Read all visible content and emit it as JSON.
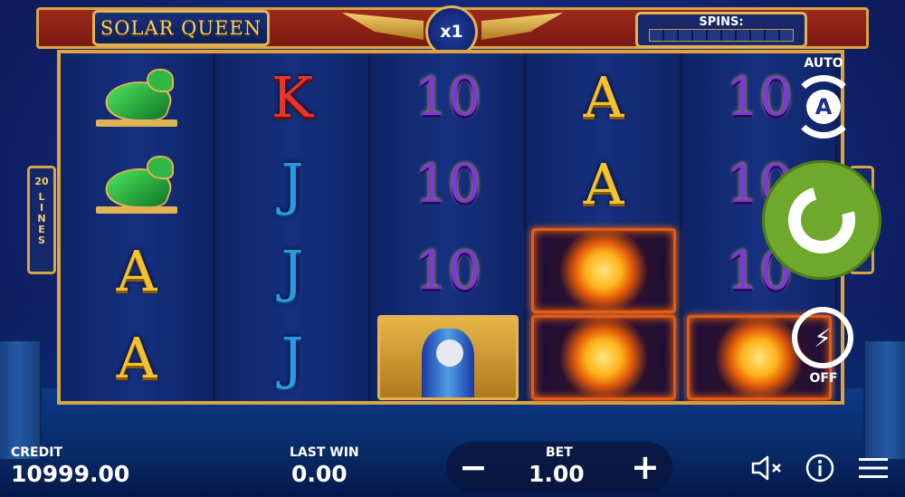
{
  "game": {
    "logo": "SOLAR QUEEN",
    "multiplier": "x1",
    "spins_label": "SPINS:",
    "lines_number": "20",
    "lines_word": "LINES"
  },
  "reels": [
    [
      "bird",
      "bird",
      "A",
      "A"
    ],
    [
      "K",
      "J",
      "J",
      "J"
    ],
    [
      "10",
      "10",
      "10",
      "horus"
    ],
    [
      "A",
      "A",
      "sun",
      "sun"
    ],
    [
      "10",
      "10",
      "10",
      "sun"
    ]
  ],
  "controls": {
    "auto_label": "AUTO",
    "auto_letter": "A",
    "turbo_state": "OFF"
  },
  "bottom": {
    "credit_label": "CREDIT",
    "credit_value": "10999.00",
    "last_win_label": "LAST WIN",
    "last_win_value": "0.00",
    "bet_label": "BET",
    "bet_value": "1.00",
    "minus": "−",
    "plus": "+"
  },
  "icons": {
    "sound": "speaker-muted-icon",
    "info": "info-icon",
    "menu": "hamburger-menu-icon"
  }
}
